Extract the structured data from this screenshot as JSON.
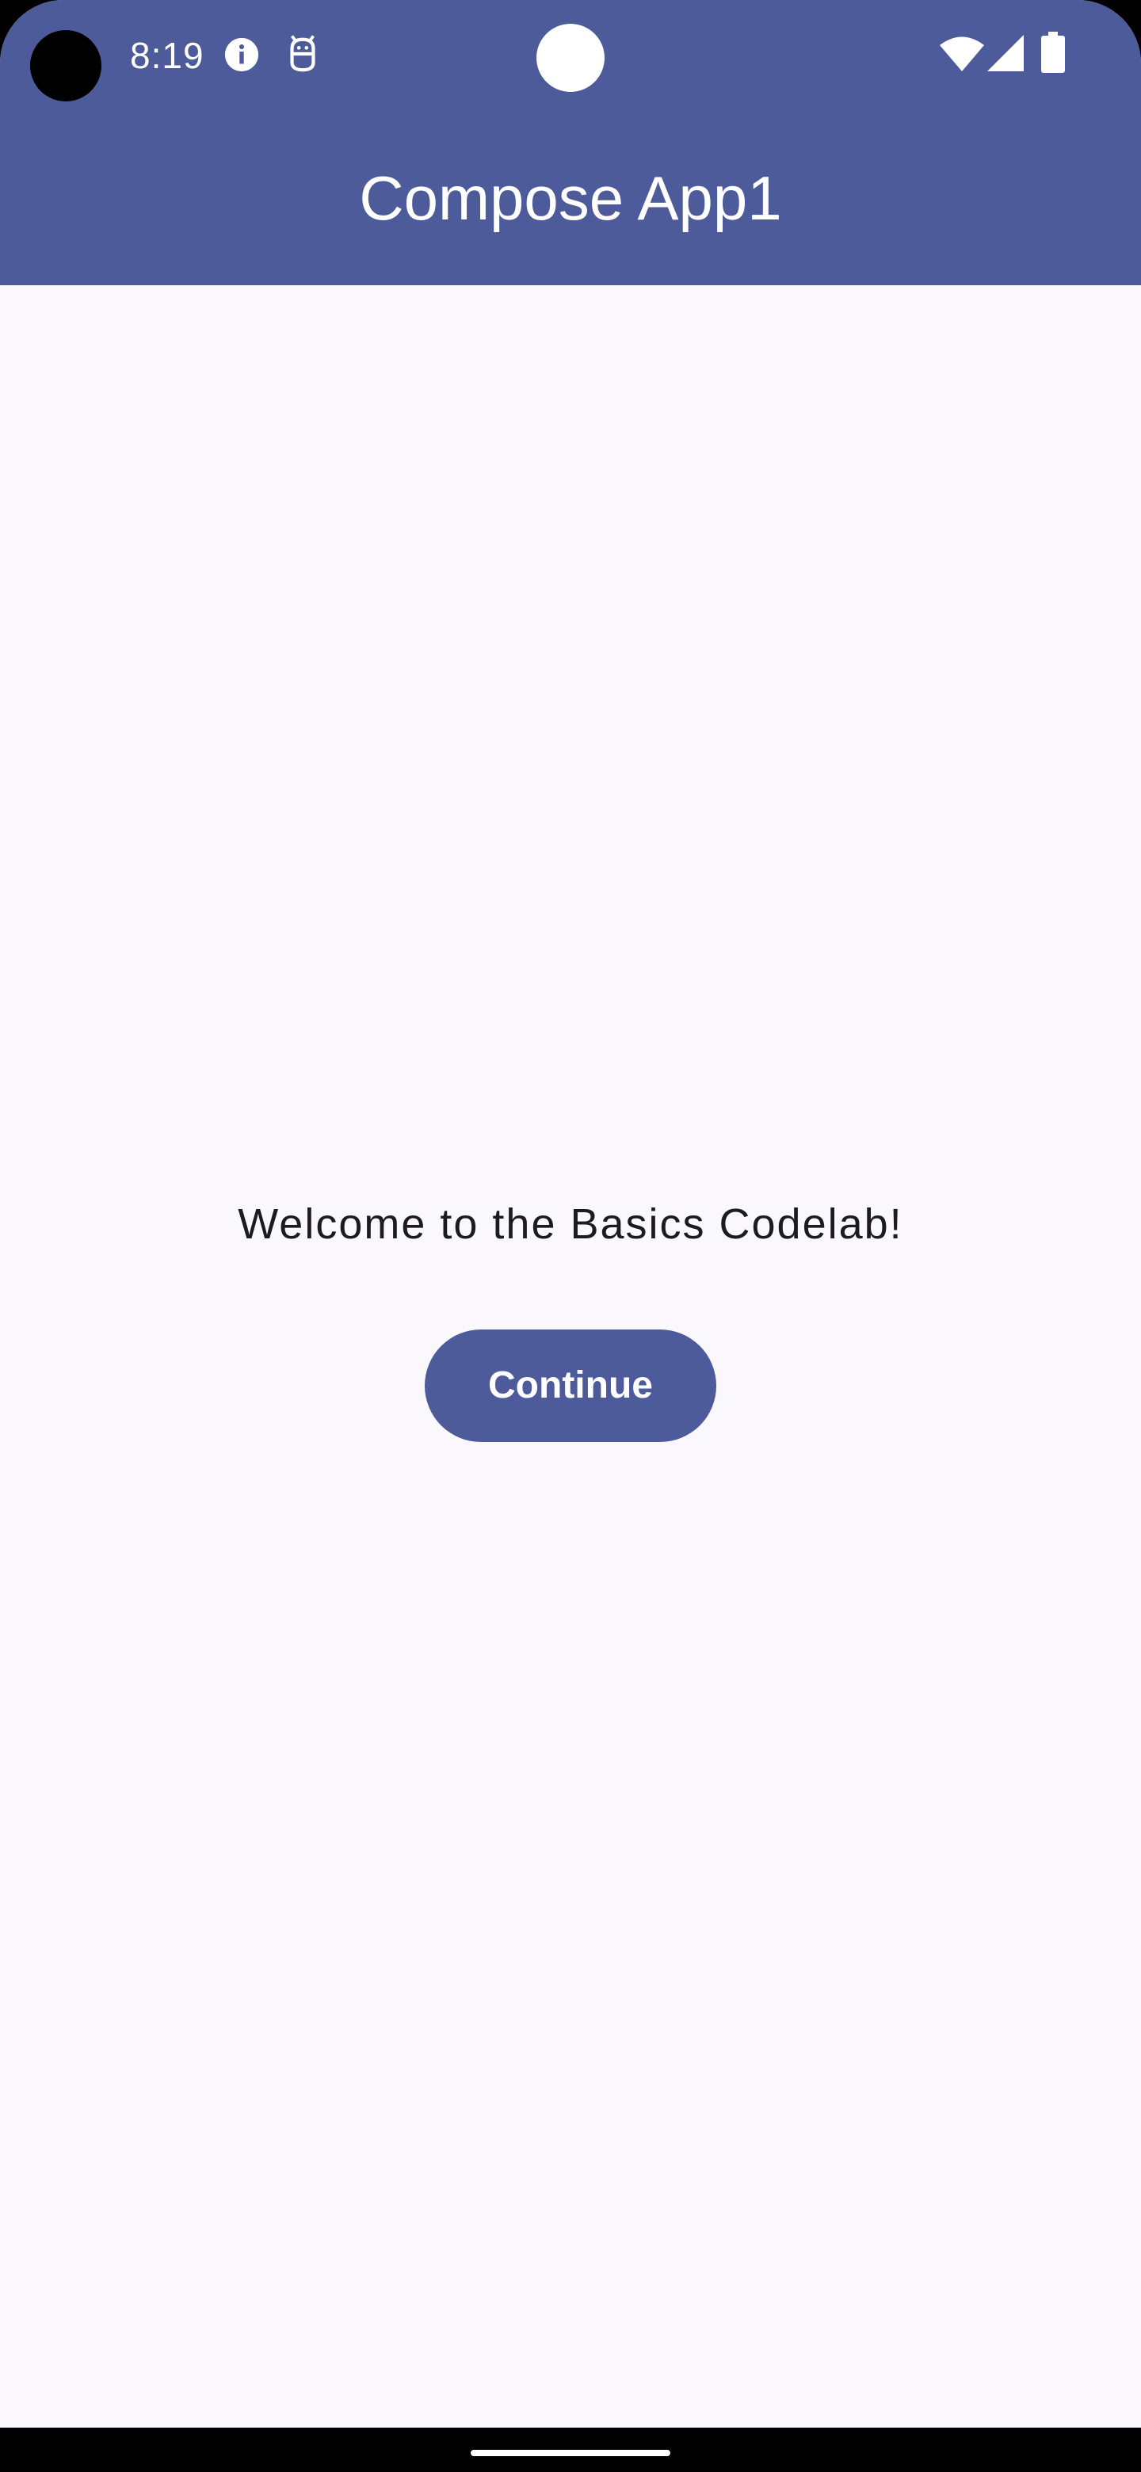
{
  "status_bar": {
    "time": "8:19",
    "icons": [
      "info-icon",
      "debug-icon",
      "wifi-icon",
      "signal-icon",
      "battery-icon"
    ]
  },
  "app_bar": {
    "title": "Compose App1"
  },
  "main": {
    "welcome_text": "Welcome to the Basics Codelab!",
    "continue_label": "Continue"
  },
  "colors": {
    "primary": "#4D5B9B",
    "background": "#FBF8FD",
    "on_primary": "#FFFFFF",
    "text": "#1B1B21"
  }
}
